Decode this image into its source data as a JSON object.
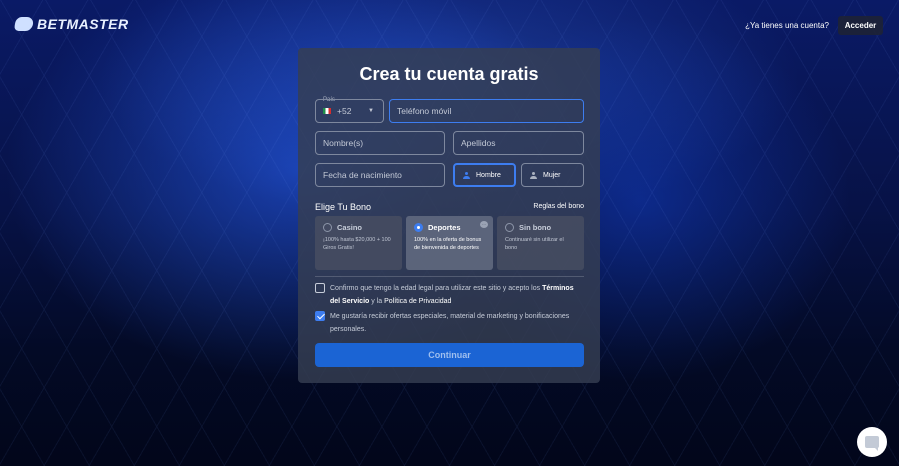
{
  "header": {
    "logo_text": "BETMASTER",
    "have_account": "¿Ya tienes una cuenta?",
    "login_label": "Acceder"
  },
  "form": {
    "title": "Crea tu cuenta gratis",
    "country_label": "País",
    "country_code": "+52",
    "phone_placeholder": "Teléfono móvil",
    "first_name_placeholder": "Nombre(s)",
    "last_name_placeholder": "Apellidos",
    "birthdate_placeholder": "Fecha de nacimiento",
    "gender": {
      "male": "Hombre",
      "female": "Mujer",
      "selected": "male"
    },
    "bonus_section_title": "Elige Tu Bono",
    "bonus_rules": "Reglas del bono",
    "bonuses": [
      {
        "title": "Casino",
        "desc": "¡100% hasta $20,000 + 100 Giros Gratis!",
        "selected": false
      },
      {
        "title": "Deportes",
        "desc": "100% en la oferta de bonus de bienvenida de deportes",
        "selected": true
      },
      {
        "title": "Sin bono",
        "desc": "Continuaré sin utilizar el bono",
        "selected": false
      }
    ],
    "legal": {
      "text_1": "Confirmo que tengo la edad legal para utilizar este sitio y acepto los",
      "terms_link": "Términos del Servicio",
      "text_2": "y la",
      "privacy_link": "Política de Privacidad",
      "checked": false
    },
    "marketing": {
      "text": "Me gustaría recibir ofertas especiales, material de marketing y bonificaciones personales.",
      "checked": true
    },
    "continue_label": "Continuar"
  },
  "colors": {
    "accent": "#1b64d4",
    "focus_border": "#3d7df0",
    "card_bg": "#363e52"
  },
  "icons": {
    "logo": "betmaster-logo-icon",
    "flag": "mexico-flag-icon",
    "chevron": "chevron-down-icon",
    "person": "person-icon",
    "info": "info-icon",
    "chat": "chat-icon"
  }
}
